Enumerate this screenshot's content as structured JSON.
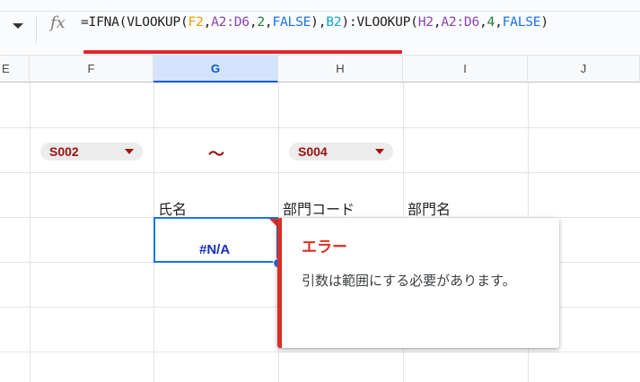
{
  "formula_bar": {
    "fx_label": "fx",
    "parts": [
      "=IFNA(VLOOKUP(",
      "F2",
      ",",
      "A2:D6",
      ",",
      "2",
      ",",
      "FALSE",
      "),",
      "B2",
      "):VLOOKUP(",
      "H2",
      ",",
      "A2:D6",
      ",",
      "4",
      ",",
      "FALSE",
      ")"
    ],
    "error_underline_color": "#e1262c"
  },
  "columns": [
    "E",
    "F",
    "G",
    "H",
    "I",
    "J"
  ],
  "selected_column": "G",
  "cells": {
    "F2_chip": "S002",
    "G2": "～",
    "H2_chip": "S004",
    "G3": "氏名",
    "H3": "部門コード",
    "I3": "部門名",
    "G4": "#N/A"
  },
  "error_popup": {
    "title": "エラー",
    "message": "引数は範囲にする必要があります。",
    "accent_color": "#d93025"
  },
  "colors": {
    "selection": "#1a73e8",
    "chip_text": "#9b0f0f",
    "na_text": "#1a2fbf"
  }
}
